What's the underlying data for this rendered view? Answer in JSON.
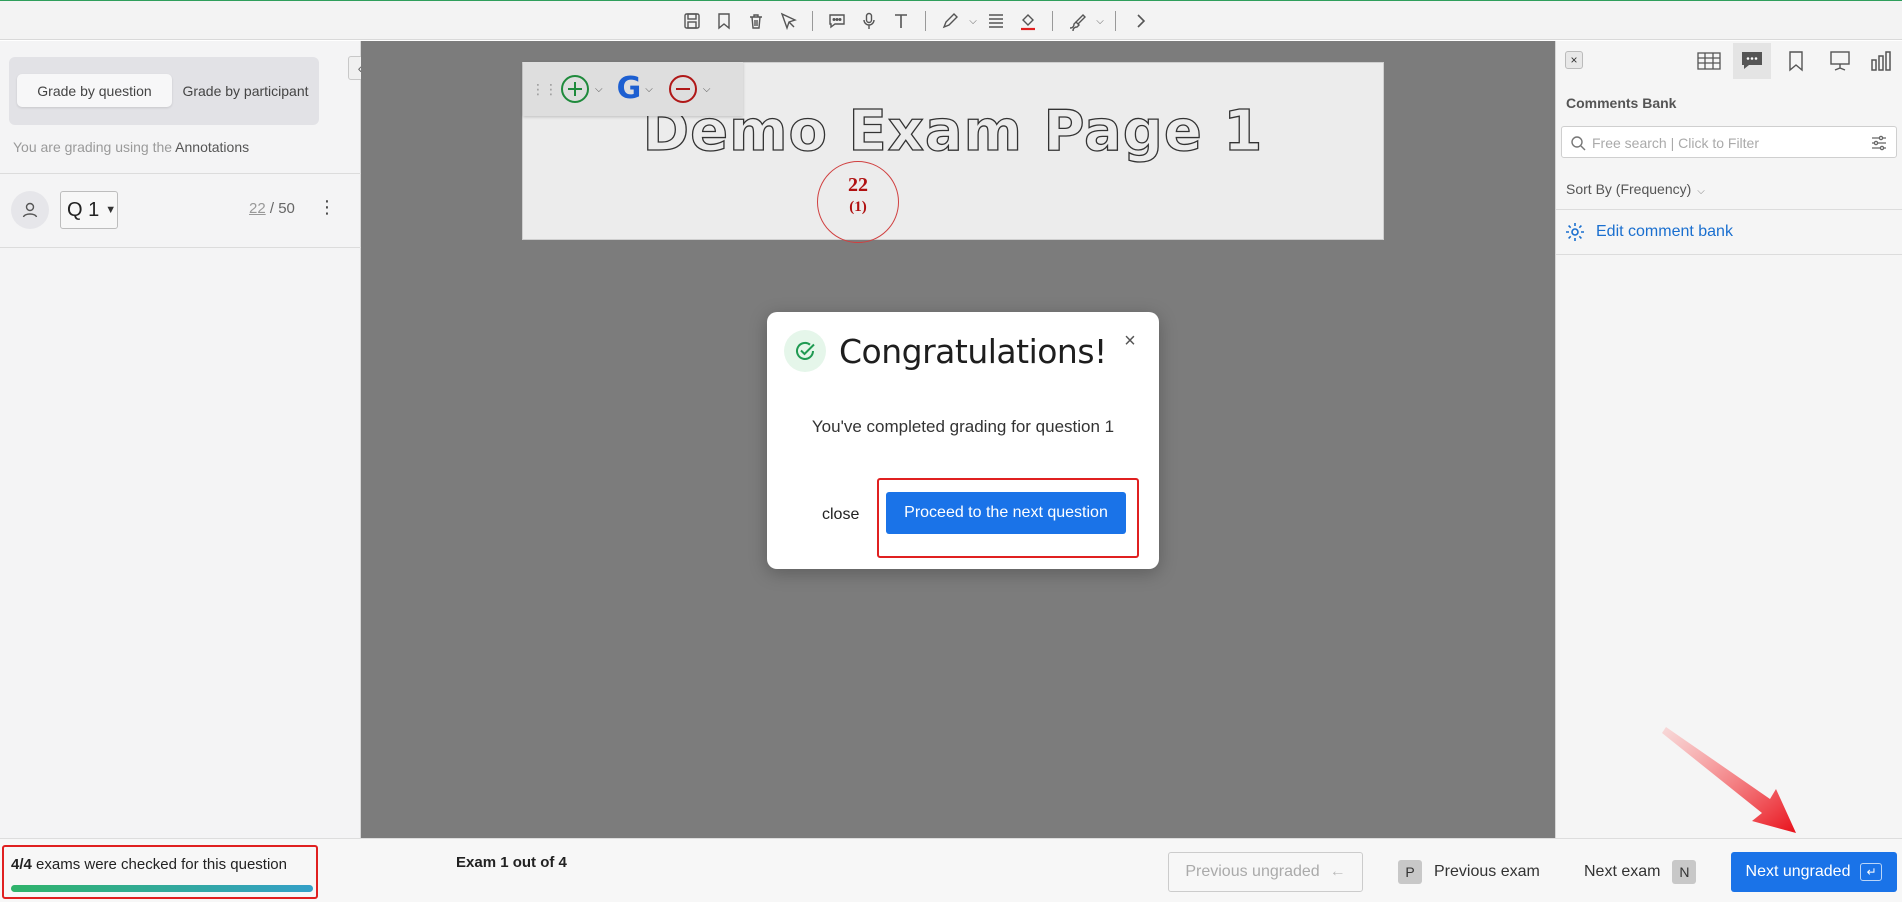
{
  "toolbar": {
    "icons": [
      "save-icon",
      "bookmark-icon",
      "trash-icon",
      "cursor-icon",
      "comment-icon",
      "microphone-icon",
      "text-icon",
      "pen-icon",
      "lines-icon",
      "fill-icon",
      "brush-icon",
      "chevron-right-icon"
    ]
  },
  "left_panel": {
    "tab_active": "Grade by question",
    "tab_other": "Grade by participant",
    "grading_note_prefix": "You are grading using the ",
    "grading_note_method": "Annotations",
    "question_select": "Q 1",
    "score_value": "22",
    "score_sep": " / ",
    "score_max": "50"
  },
  "viewer": {
    "page_title": "Demo Exam Page 1",
    "stamp_score": "22",
    "stamp_sub": "(1)",
    "float_tools": [
      "plus-circle-icon",
      "google-icon",
      "minus-circle-icon"
    ]
  },
  "modal": {
    "title": "Congratulations!",
    "message": "You've completed grading for question 1",
    "close_label": "close",
    "proceed_label": "Proceed to the next question"
  },
  "right_panel": {
    "title": "Comments Bank",
    "search_placeholder": "Free search | Click to Filter",
    "sort_label": "Sort By (Frequency)",
    "edit_label": "Edit comment bank",
    "tabs": [
      "table-icon",
      "comment-bubble-icon",
      "bookmark-icon",
      "presentation-icon",
      "bar-chart-icon"
    ]
  },
  "bottom_bar": {
    "checked_count": "4/4",
    "checked_text": " exams were checked for this question",
    "progress_fraction": 1.0,
    "exam_position": "Exam 1 out of 4",
    "prev_ungraded": "Previous ungraded",
    "prev_exam_key": "P",
    "prev_exam": "Previous exam",
    "next_exam": "Next exam",
    "next_exam_key": "N",
    "next_ungraded": "Next ungraded"
  },
  "colors": {
    "primary": "#1a73e8",
    "highlight": "#e02020",
    "success": "#2fb36a",
    "stamp": "#b01010"
  }
}
